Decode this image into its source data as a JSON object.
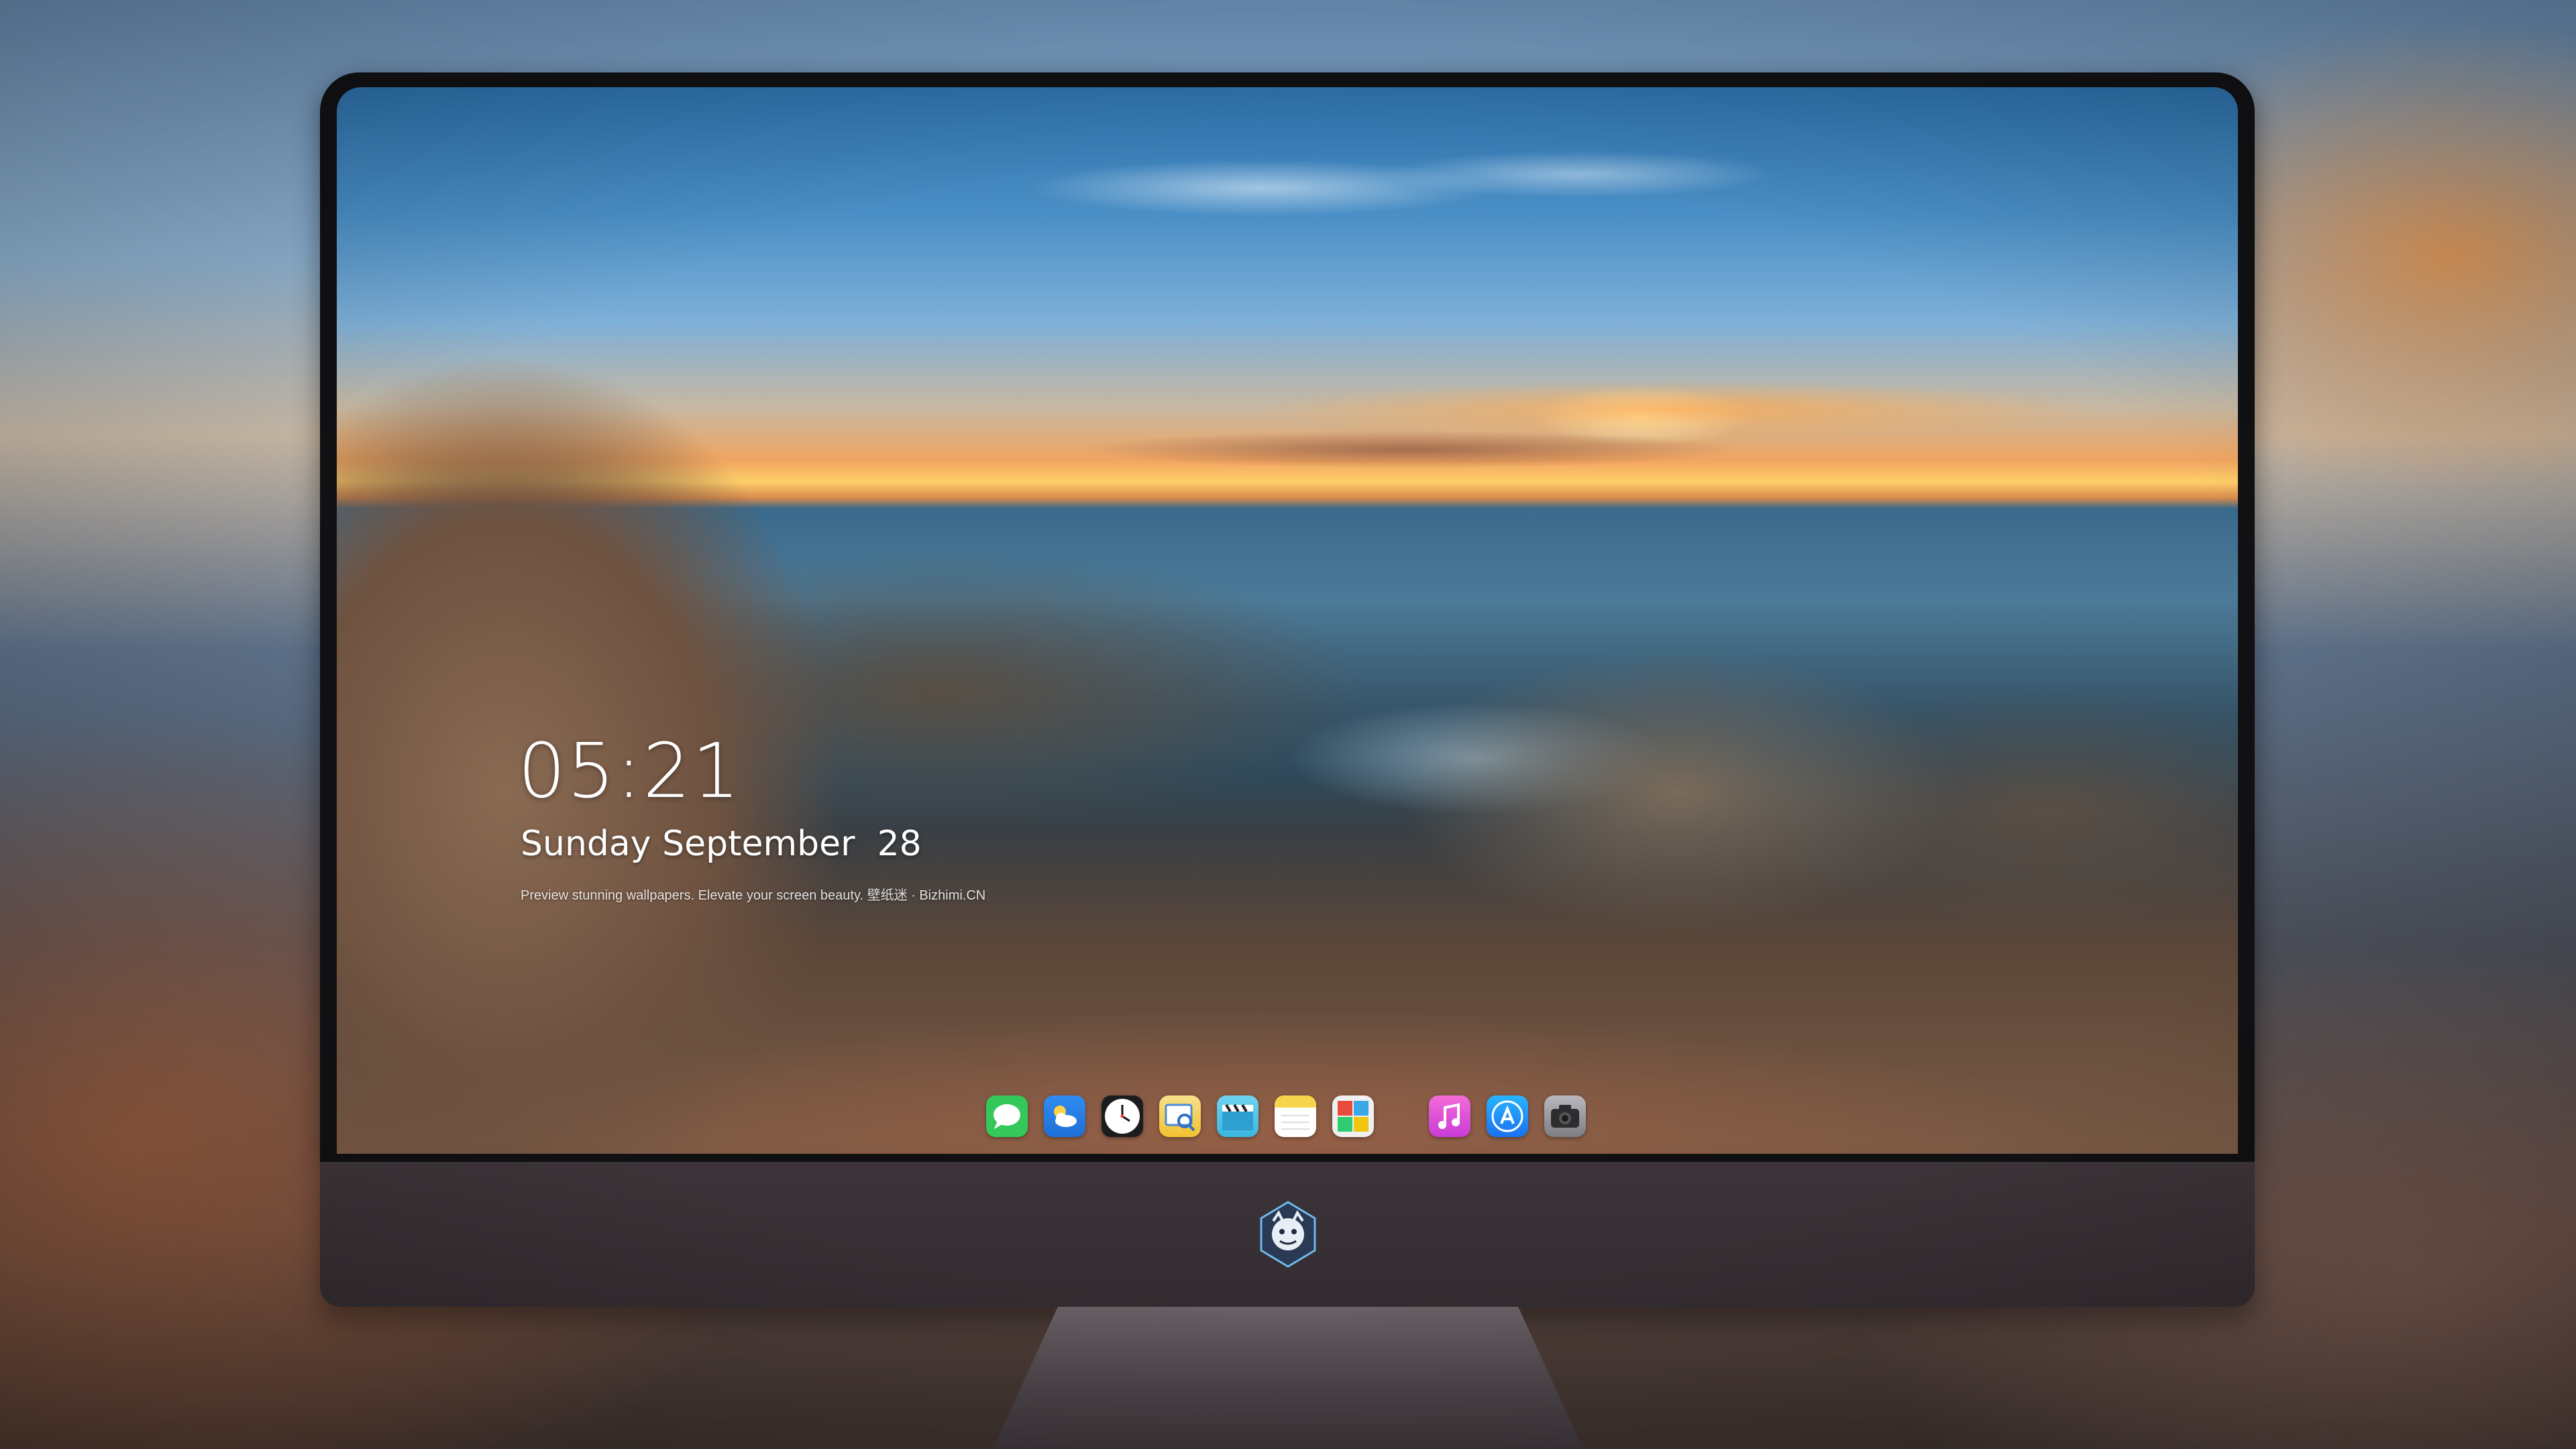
{
  "lockscreen": {
    "time": "05:21",
    "date": "Sunday September  28",
    "caption": "Preview stunning wallpapers. Elevate your screen beauty. 壁纸迷 · Bizhimi.CN"
  },
  "dock": {
    "apps": [
      {
        "name": "messages-icon",
        "color": "#34c759"
      },
      {
        "name": "weather-icon",
        "color": "#2f8cf0"
      },
      {
        "name": "clock-icon",
        "color": "#1c1c1e"
      },
      {
        "name": "preview-icon",
        "color": "#f2c230"
      },
      {
        "name": "clips-icon",
        "color": "#56c8ea"
      },
      {
        "name": "notes-icon",
        "color": "#f7d54a"
      },
      {
        "name": "photo-booth-icon",
        "color": "#3aa7e8"
      },
      {
        "name": "music-icon",
        "color": "#e946c8"
      },
      {
        "name": "app-store-icon",
        "color": "#1a8cf5"
      },
      {
        "name": "camera-icon",
        "color": "#8e8e93"
      }
    ]
  },
  "accent": {
    "screen_text": "#ffffff",
    "bezel": "#111114",
    "chin": "#3c3438"
  }
}
